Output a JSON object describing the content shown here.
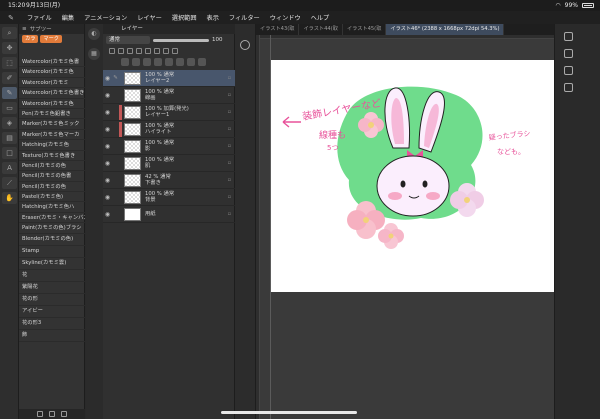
{
  "status": {
    "time": "15:20",
    "date": "9月13日(月)",
    "battery": "99%"
  },
  "menu": [
    "ファイル",
    "編集",
    "アニメーション",
    "レイヤー",
    "選択範囲",
    "表示",
    "フィルター",
    "ウィンドウ",
    "ヘルプ"
  ],
  "subtool": {
    "header": "サブツー",
    "tab_a": "カラ",
    "tab_b": "マーク",
    "brushes": [
      "Watercolor(カモミ色書",
      "Watercolor(カモミ色",
      "Watercolor(カモミ",
      "Watercolor(カモミ色書き",
      "Watercolor(カモミ色",
      "Pen(カモミ色鉛書き",
      "Marker(カモミ色ミック",
      "Marker(カモミ色マーカ",
      "Hatching(カモミ色",
      "Texture(カモミ色書き",
      "Pencil(カモミの色",
      "Pencil(カモミの色書",
      "Pencil(カモミの色",
      "Pastel(カモミ色)",
      "Hatching(カモミ色ハ",
      "Eraser(カモミ・キャンバス",
      "Paint(カモミの色)ブラシ"
    ],
    "brushes_lower": [
      "Blender(カモミの色)",
      "Stamp",
      "Skyline(カモミ雲)",
      "花",
      "紫陽花",
      "花の形",
      "アイビー",
      "花の形3",
      "飾"
    ]
  },
  "layers": {
    "tab": "レイヤー",
    "blend_mode": "通常",
    "opacity": "100",
    "items": [
      {
        "pct": "100 %",
        "mode": "通常",
        "name": "レイヤー2",
        "selected": true,
        "clip": "none",
        "thumb": "checker"
      },
      {
        "pct": "100 %",
        "mode": "通常",
        "name": "線画",
        "selected": false,
        "clip": "none",
        "thumb": "checker"
      },
      {
        "pct": "100 %",
        "mode": "加算(発光)",
        "name": "レイヤー1",
        "selected": false,
        "clip": "red",
        "thumb": "checker"
      },
      {
        "pct": "100 %",
        "mode": "通常",
        "name": "ハイライト",
        "selected": false,
        "clip": "red",
        "thumb": "checker"
      },
      {
        "pct": "100 %",
        "mode": "通常",
        "name": "影",
        "selected": false,
        "clip": "none",
        "thumb": "checker"
      },
      {
        "pct": "100 %",
        "mode": "通常",
        "name": "肌",
        "selected": false,
        "clip": "none",
        "thumb": "checker"
      },
      {
        "pct": "42 %",
        "mode": "通常",
        "name": "下書き",
        "selected": false,
        "clip": "none",
        "thumb": "checker"
      },
      {
        "pct": "100 %",
        "mode": "通常",
        "name": "背景",
        "selected": false,
        "clip": "none",
        "thumb": "checker"
      },
      {
        "pct": "",
        "mode": "",
        "name": "用紙",
        "selected": false,
        "clip": "none",
        "thumb": "white"
      }
    ]
  },
  "doctabs": [
    {
      "label": "イラスト43(取",
      "active": false
    },
    {
      "label": "イラスト44(取",
      "active": false
    },
    {
      "label": "イラスト45(取",
      "active": false
    },
    {
      "label": "イラスト46* (2388 x 1668px 72dpi 54.3%)",
      "active": true
    }
  ],
  "canvas": {
    "annotation_left": "装飾レイヤーなど",
    "annotation_left2": "線種も",
    "annotation_left3": "5つ",
    "annotation_right": "疑ったブラシ",
    "annotation_right2": "なども。",
    "colors": {
      "green": "#6fdc8c",
      "pink": "#e8529a",
      "rabbit_shadow": "#f4c8ea",
      "flower": "#f6b6c8"
    }
  },
  "icons": [
    "apple-pencil-icon",
    "wifi-icon",
    "battery-icon",
    "eye-icon",
    "lock-icon",
    "add-layer-icon",
    "trash-icon",
    "rotate-icon"
  ]
}
